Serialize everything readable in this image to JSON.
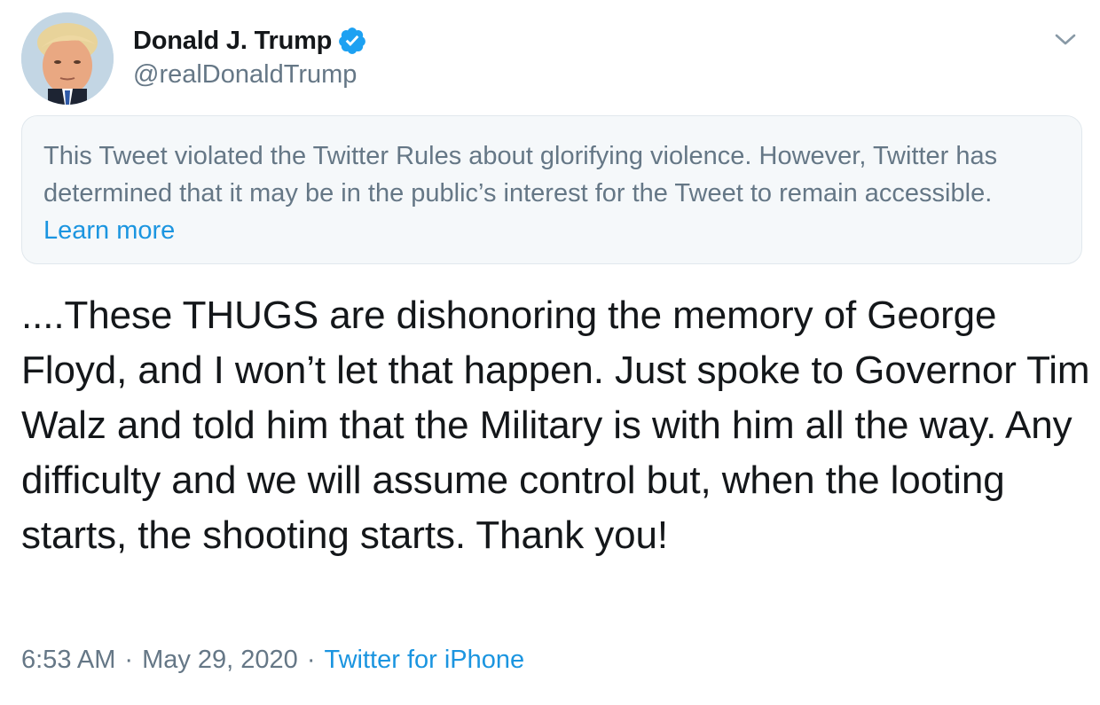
{
  "user": {
    "display_name": "Donald J. Trump",
    "handle": "@realDonaldTrump",
    "verified": true
  },
  "notice": {
    "text": "This Tweet violated the Twitter Rules about glorifying violence. However, Twitter has determined that it may be in the public’s interest for the Tweet to remain accessible. ",
    "link_label": "Learn more"
  },
  "tweet": {
    "text": "....These THUGS are dishonoring the memory of George Floyd, and I won’t let that happen. Just spoke to Governor Tim Walz and told him that the Military is with him all the way. Any difficulty and we will assume control but, when the looting starts, the shooting starts. Thank you!",
    "time": "6:53 AM",
    "separator": "·",
    "date": "May 29, 2020",
    "source": "Twitter for iPhone"
  },
  "icons": {
    "verified": "verified-badge-icon",
    "more": "chevron-down-icon"
  },
  "colors": {
    "link_blue": "#1b95e0",
    "verified_blue": "#1da1f2",
    "secondary_text": "#657786",
    "notice_bg": "#f5f8fa"
  }
}
